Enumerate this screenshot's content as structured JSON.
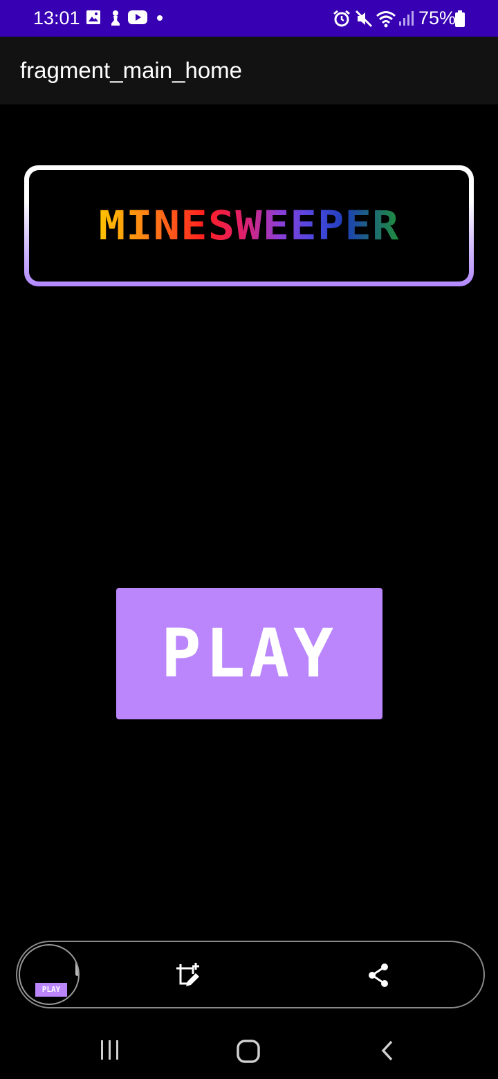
{
  "status_bar": {
    "time": "13:01",
    "battery": "75%",
    "left_icons": [
      "gallery-icon",
      "chess-pawn-icon",
      "youtube-icon",
      "dot-icon"
    ],
    "right_icons": [
      "alarm-icon",
      "mute-icon",
      "wifi-icon",
      "signal-icon",
      "battery-icon"
    ],
    "color": "#3700b3"
  },
  "app_bar": {
    "title": "fragment_main_home"
  },
  "main": {
    "title": "MINESWEEPER",
    "play_label": "PLAY",
    "accent": "#bb86fc"
  },
  "toolbar": {
    "thumbnail_label": "PLAY",
    "icons": [
      "crop-edit-icon",
      "share-icon"
    ]
  },
  "nav_bar": {
    "icons": [
      "recents-icon",
      "home-icon",
      "back-icon"
    ]
  }
}
